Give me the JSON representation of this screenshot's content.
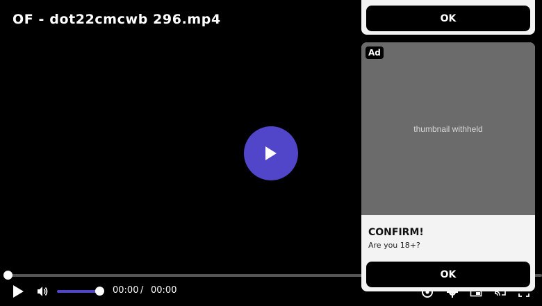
{
  "player": {
    "title": "OF - dot22cmcwb 296.mp4",
    "accent_color": "#5146c9",
    "progress": 0,
    "volume": 1,
    "time_current": "00:00",
    "time_separator": "/",
    "time_duration": "00:00",
    "icons": [
      "play-icon",
      "volume-icon",
      "chromecast-icon",
      "gear-icon",
      "pip-icon",
      "airplay-icon",
      "fullscreen-icon"
    ]
  },
  "ad_top": {
    "button_label": "OK"
  },
  "ad_card": {
    "badge": "Ad",
    "image_note": "thumbnail withheld",
    "headline": "CONFIRM!",
    "subtext": "Are you 18+?",
    "button_label": "OK"
  }
}
